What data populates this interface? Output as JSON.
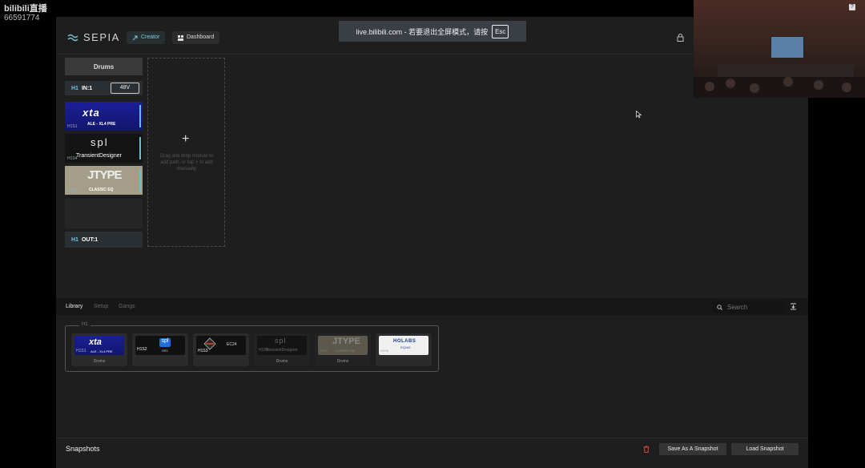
{
  "overlay": {
    "logo": "bilibili直播",
    "room_id": "66591774"
  },
  "browser_tip": {
    "message": "live.bilibili.com - 若要退出全屏模式，请按",
    "key": "Esc"
  },
  "app": {
    "brand": "SEPIA",
    "nav": {
      "creator": "Creator",
      "dashboard": "Dashboard"
    },
    "accent": "#6fc4dc"
  },
  "path": {
    "name": "Drums",
    "input": {
      "channel": "H1",
      "label": "IN:1",
      "phantom": "48V"
    },
    "modules": [
      {
        "slot": "H1S1",
        "brand": "xta",
        "model": "ALE - XL4 PRE"
      },
      {
        "slot": "H1S4",
        "brand": "spl",
        "model": "TransientDesigner"
      },
      {
        "slot": "H1S5",
        "brand": "JTYPE",
        "model": "CLASSIC EQ"
      }
    ],
    "output": {
      "channel": "H1",
      "label": "OUT:1"
    }
  },
  "dropzone": {
    "plus": "+",
    "hint": "Drag and drop module to add path, or tap + to add manually"
  },
  "library": {
    "tabs": [
      "Library",
      "Setup",
      "Gangs"
    ],
    "search_placeholder": "Search",
    "group": "H1",
    "cards": [
      {
        "slot": "H1S1",
        "brand": "xta",
        "model": "ALE - XL4 PRE",
        "path": "Drums"
      },
      {
        "slot": "H1S2",
        "brand": "spl",
        "model": "SR2",
        "path": ""
      },
      {
        "slot": "H1S3",
        "brand": "",
        "model": "EC24",
        "path": ""
      },
      {
        "slot": "H1S4",
        "brand": "spl",
        "model": "TransientDesigner",
        "path": "Drums"
      },
      {
        "slot": "H1S5",
        "brand": "JTYPE",
        "model": "CLASSIC EQ",
        "path": "Drums"
      },
      {
        "slot": "H1S6",
        "brand": "HOLABS",
        "model": "EQ169",
        "path": ""
      }
    ]
  },
  "snapshots": {
    "title": "Snapshots",
    "save": "Save As A Snapshot",
    "load": "Load Snapshot"
  }
}
